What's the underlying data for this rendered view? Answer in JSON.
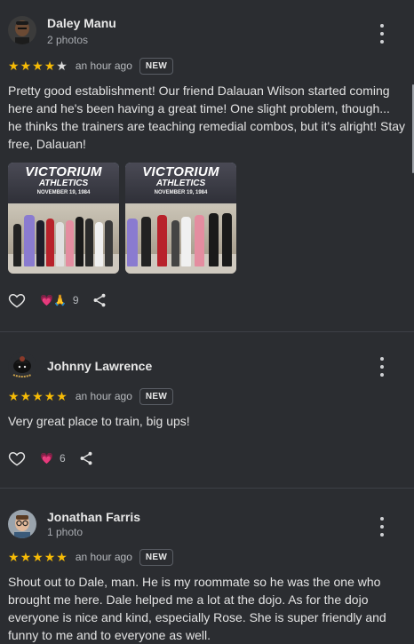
{
  "reviews": [
    {
      "name": "Daley Manu",
      "subtitle": "2 photos",
      "rating": 4,
      "max_rating": 5,
      "time": "an hour ago",
      "badge": "NEW",
      "text": "Pretty good establishment! Our friend Dalauan Wilson started coming here and he's been having a great time! One slight problem, though... he thinks the trainers are teaching remedial combos, but it's alright! Stay free, Dalauan!",
      "photos": [
        {
          "line1": "VICTORIUM",
          "line2": "ATHLETICS",
          "line3": "NOVEMBER 19, 1984"
        },
        {
          "line1": "VICTORIUM",
          "line2": "ATHLETICS",
          "line3": "NOVEMBER 19, 1984"
        }
      ],
      "reaction_count": "9",
      "reaction_emojis": "💗🙏"
    },
    {
      "name": "Johnny Lawrence",
      "subtitle": "",
      "rating": 5,
      "max_rating": 5,
      "time": "an hour ago",
      "badge": "NEW",
      "text": "Very great place to train, big ups!",
      "reaction_count": "6",
      "reaction_emojis": "💗"
    },
    {
      "name": "Jonathan Farris",
      "subtitle": "1 photo",
      "rating": 5,
      "max_rating": 5,
      "time": "an hour ago",
      "badge": "NEW",
      "text": "Shout out to Dale, man. He is my roommate so he was the one who brought me here. Dale helped me a lot at the dojo. As for the dojo everyone is nice and kind, especially Rose. She is super friendly and funny to me and to everyone as well."
    }
  ],
  "colors": {
    "background": "#2b2d31",
    "star": "#f6bb06",
    "reaction_heart": "#ff4b7d"
  }
}
